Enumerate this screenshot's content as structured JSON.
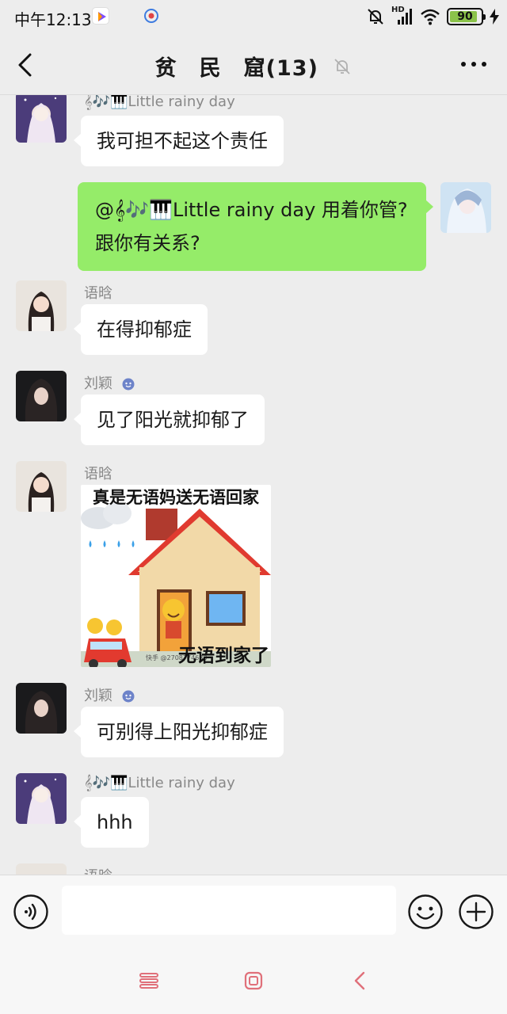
{
  "status_bar": {
    "time": "中午12:13",
    "network_label": "HD",
    "battery": "90",
    "battery_level": 0.9
  },
  "header": {
    "back_icon": "chevron-left-icon",
    "title": "贫　民　窟(13)",
    "mute_icon": "bell-off-icon",
    "more_icon": "more-dots-icon"
  },
  "messages": [
    {
      "sender": "𝄞🎶🎹Little rainy day",
      "text": "我可担不起这个责任",
      "direction": "in"
    },
    {
      "sender": "",
      "text": "@𝄞🎶🎹Little rainy day  用着你管? 跟你有关系?",
      "direction": "out"
    },
    {
      "sender": "语晗",
      "text": "在得抑郁症",
      "direction": "in"
    },
    {
      "sender": "刘颖",
      "text": "见了阳光就抑郁了",
      "direction": "in"
    },
    {
      "sender": "语晗",
      "sticker_top": "真是无语妈送无语回家",
      "sticker_bottom": "无语到家了",
      "sticker_watermark": "快手 @2708774683",
      "direction": "in"
    },
    {
      "sender": "刘颖",
      "text": "可别得上阳光抑郁症",
      "direction": "in"
    },
    {
      "sender": "𝄞🎶🎹Little rainy day",
      "text": "hhh",
      "direction": "in"
    },
    {
      "sender": "语晗",
      "direction": "in"
    }
  ],
  "input_bar": {
    "voice_icon": "voice-icon",
    "input_value": "",
    "emoji_icon": "emoji-icon",
    "plus_icon": "plus-icon"
  },
  "nav_bar": {
    "menu_icon": "menu-icon",
    "home_icon": "home-icon",
    "back_icon": "back-icon"
  },
  "colors": {
    "background": "#ededed",
    "outgoing_bubble": "#95ec69",
    "incoming_bubble": "#ffffff",
    "nav_icons": "#e0707a",
    "battery_fill": "#8bc34a"
  }
}
